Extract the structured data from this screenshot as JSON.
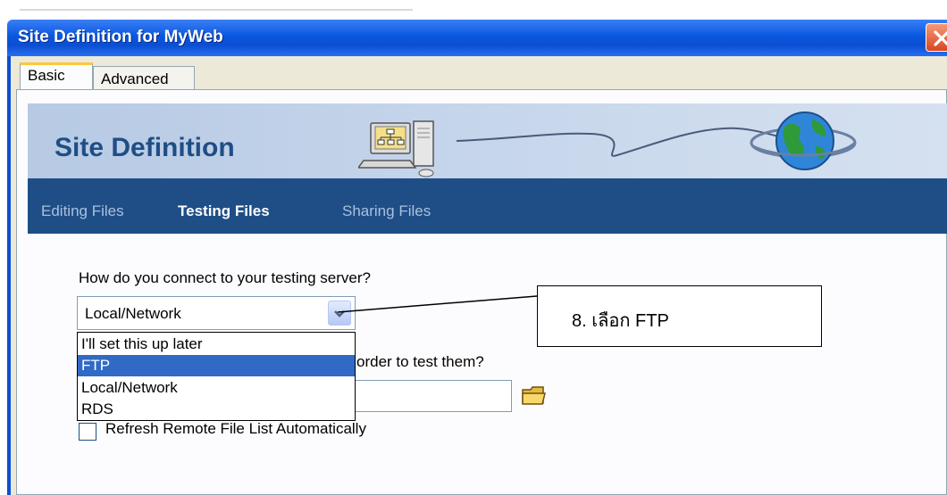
{
  "window": {
    "title": "Site Definition for MyWeb"
  },
  "tabs": [
    {
      "label": "Basic",
      "active": true
    },
    {
      "label": "Advanced",
      "active": false
    }
  ],
  "banner": {
    "title": "Site Definition",
    "icons": [
      "computer-network-icon",
      "globe-icon"
    ]
  },
  "wizard_steps": [
    {
      "label": "Editing Files",
      "state": "done"
    },
    {
      "label": "Testing Files",
      "state": "current"
    },
    {
      "label": "Sharing Files",
      "state": "upcoming"
    }
  ],
  "form": {
    "question": "How do you connect to your testing server?",
    "connection_select": {
      "value": "Local/Network",
      "options": [
        "I'll set this up later",
        "FTP",
        "Local/Network",
        "RDS"
      ],
      "highlighted": "FTP"
    },
    "question2_visible_tail": "order to test them?",
    "refresh_checkbox": {
      "label": "Refresh Remote File List Automatically",
      "checked": false
    }
  },
  "callout": {
    "text": "8.  เลือก FTP"
  },
  "colors": {
    "title_bar": "#0a4fd3",
    "banner_bg": "#c9d8ec",
    "nav_bar": "#1f4e86",
    "selection": "#316ac5",
    "dialog_bg": "#ece9d8"
  }
}
